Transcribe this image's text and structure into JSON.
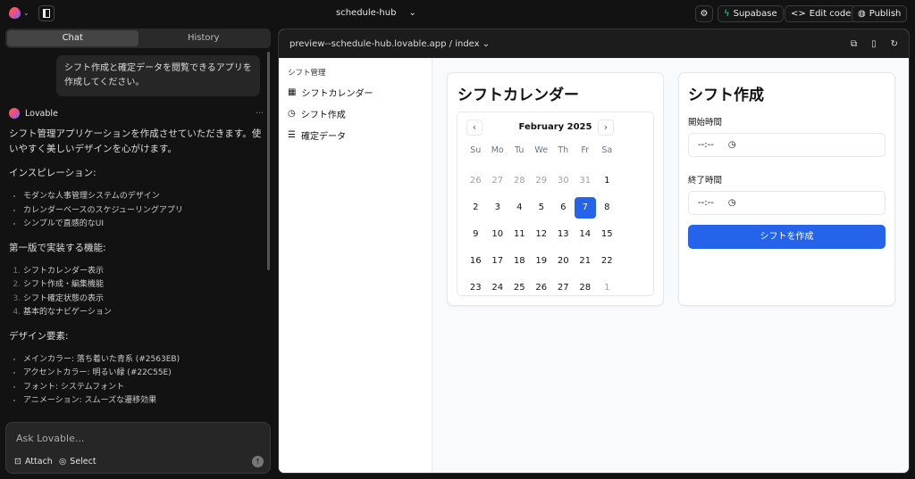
{
  "topbar": {
    "project": "schedule-hub",
    "supabase": "Supabase",
    "edit_code": "Edit code",
    "publish": "Publish"
  },
  "tabs": {
    "chat": "Chat",
    "history": "History"
  },
  "chat": {
    "user_message": "シフト作成と確定データを閲覧できるアプリを作成してください。",
    "bot_name": "Lovable",
    "more": "···",
    "intro": "シフト管理アプリケーションを作成させていただきます。使いやすく美しいデザインを心がけます。",
    "inspiration_title": "インスピレーション:",
    "inspiration": [
      "モダンな人事管理システムのデザイン",
      "カレンダーベースのスケジューリングアプリ",
      "シンプルで直感的なUI"
    ],
    "features_title": "第一版で実装する機能:",
    "features": [
      "シフトカレンダー表示",
      "シフト作成・編集機能",
      "シフト確定状態の表示",
      "基本的なナビゲーション"
    ],
    "design_title": "デザイン要素:",
    "design": [
      "メインカラー: 落ち着いた青系 (#2563EB)",
      "アクセントカラー: 明るい緑 (#22C55E)",
      "フォント: システムフォント",
      "アニメーション: スムーズな遷移効果"
    ]
  },
  "composer": {
    "placeholder": "Ask Lovable...",
    "attach": "Attach",
    "select": "Select"
  },
  "preview": {
    "url": "preview--schedule-hub.lovable.app / index",
    "sidebar": {
      "group": "シフト管理",
      "items": [
        "シフトカレンダー",
        "シフト作成",
        "確定データ"
      ]
    },
    "calendar": {
      "title": "シフトカレンダー",
      "month": "February 2025",
      "weekdays": [
        "Su",
        "Mo",
        "Tu",
        "We",
        "Th",
        "Fr",
        "Sa"
      ],
      "days": [
        [
          "26",
          1
        ],
        [
          "27",
          1
        ],
        [
          "28",
          1
        ],
        [
          "29",
          1
        ],
        [
          "30",
          1
        ],
        [
          "31",
          1
        ],
        [
          "1",
          0
        ],
        [
          "2",
          0
        ],
        [
          "3",
          0
        ],
        [
          "4",
          0
        ],
        [
          "5",
          0
        ],
        [
          "6",
          0
        ],
        [
          "7",
          0
        ],
        [
          "8",
          0
        ],
        [
          "9",
          0
        ],
        [
          "10",
          0
        ],
        [
          "11",
          0
        ],
        [
          "12",
          0
        ],
        [
          "13",
          0
        ],
        [
          "14",
          0
        ],
        [
          "15",
          0
        ],
        [
          "16",
          0
        ],
        [
          "17",
          0
        ],
        [
          "18",
          0
        ],
        [
          "19",
          0
        ],
        [
          "20",
          0
        ],
        [
          "21",
          0
        ],
        [
          "22",
          0
        ],
        [
          "23",
          0
        ],
        [
          "24",
          0
        ],
        [
          "25",
          0
        ],
        [
          "26",
          0
        ],
        [
          "27",
          0
        ],
        [
          "28",
          0
        ],
        [
          "1",
          1
        ]
      ],
      "selected": "7"
    },
    "form": {
      "title": "シフト作成",
      "start_label": "開始時間",
      "start_value": "--:--",
      "end_label": "終了時間",
      "end_value": "--:--",
      "submit": "シフトを作成"
    }
  },
  "colors": {
    "primary": "#2563EB"
  }
}
